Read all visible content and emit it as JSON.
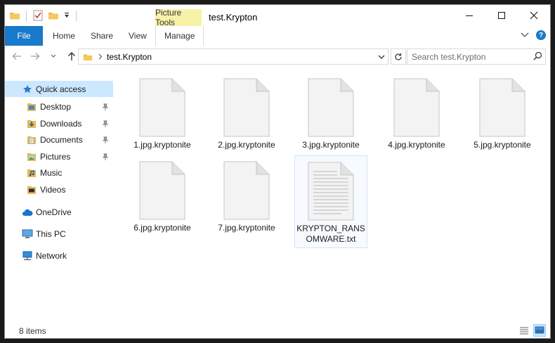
{
  "window": {
    "title": "test.Krypton",
    "context_tab": "Picture Tools"
  },
  "ribbon": {
    "tabs": [
      "File",
      "Home",
      "Share",
      "View",
      "Manage"
    ],
    "help": "?"
  },
  "address": {
    "path": "test.Krypton",
    "search_placeholder": "Search test.Krypton"
  },
  "nav": {
    "items": [
      {
        "label": "Quick access",
        "icon": "star-icon"
      },
      {
        "label": "Desktop",
        "icon": "folder-desktop-icon"
      },
      {
        "label": "Downloads",
        "icon": "folder-downloads-icon"
      },
      {
        "label": "Documents",
        "icon": "folder-documents-icon"
      },
      {
        "label": "Pictures",
        "icon": "folder-pictures-icon"
      },
      {
        "label": "Music",
        "icon": "folder-music-icon"
      },
      {
        "label": "Videos",
        "icon": "folder-videos-icon"
      },
      {
        "label": "OneDrive",
        "icon": "cloud-icon"
      },
      {
        "label": "This PC",
        "icon": "computer-icon"
      },
      {
        "label": "Network",
        "icon": "network-icon"
      }
    ]
  },
  "files": [
    {
      "name": "1.jpg.kryptonite",
      "type": "blank"
    },
    {
      "name": "2.jpg.kryptonite",
      "type": "blank"
    },
    {
      "name": "3.jpg.kryptonite",
      "type": "blank"
    },
    {
      "name": "4.jpg.kryptonite",
      "type": "blank"
    },
    {
      "name": "5.jpg.kryptonite",
      "type": "blank"
    },
    {
      "name": "6.jpg.kryptonite",
      "type": "blank"
    },
    {
      "name": "7.jpg.kryptonite",
      "type": "blank"
    },
    {
      "name": "KRYPTON_RANSOMWARE.txt",
      "type": "text"
    }
  ],
  "status": {
    "item_count": "8 items"
  },
  "colors": {
    "accent": "#1979ca",
    "context_tab_bg": "#f7f2a8",
    "selection": "#cce8ff"
  }
}
